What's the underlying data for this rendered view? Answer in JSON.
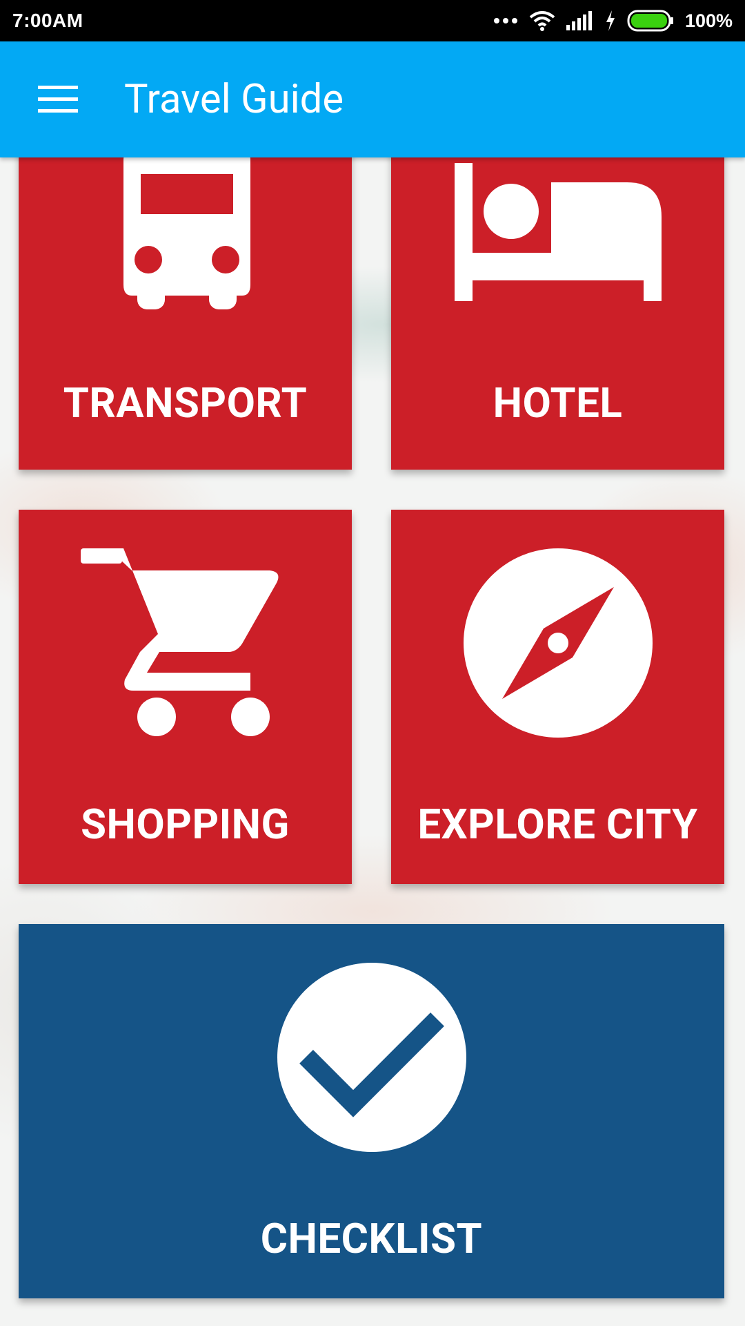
{
  "status_bar": {
    "time": "7:00AM",
    "battery": "100%",
    "icons": [
      "more-dots-icon",
      "wifi-icon",
      "signal-icon",
      "charging-icon",
      "battery-icon"
    ]
  },
  "app_bar": {
    "title": "Travel Guide",
    "menu_icon": "menu-icon",
    "background": "#03a9f4"
  },
  "tiles": [
    {
      "label": "TRANSPORT",
      "icon": "bus-icon",
      "color": "#cc1f28"
    },
    {
      "label": "HOTEL",
      "icon": "bed-icon",
      "color": "#cc1f28"
    },
    {
      "label": "SHOPPING",
      "icon": "shopping-cart-icon",
      "color": "#cc1f28"
    },
    {
      "label": "EXPLORE CITY",
      "icon": "compass-icon",
      "color": "#cc1f28"
    },
    {
      "label": "CHECKLIST",
      "icon": "check-circle-icon",
      "color": "#155487"
    }
  ]
}
